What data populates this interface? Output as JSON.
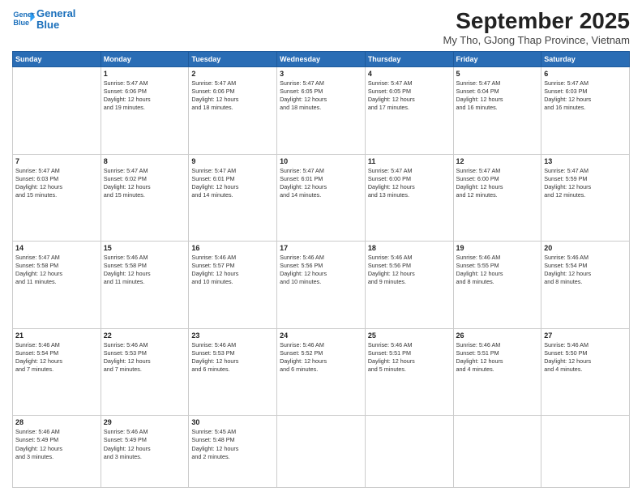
{
  "header": {
    "logo_line1": "General",
    "logo_line2": "Blue",
    "title": "September 2025",
    "subtitle": "My Tho, GJong Thap Province, Vietnam"
  },
  "weekdays": [
    "Sunday",
    "Monday",
    "Tuesday",
    "Wednesday",
    "Thursday",
    "Friday",
    "Saturday"
  ],
  "weeks": [
    [
      {
        "day": "",
        "info": ""
      },
      {
        "day": "1",
        "info": "Sunrise: 5:47 AM\nSunset: 6:06 PM\nDaylight: 12 hours\nand 19 minutes."
      },
      {
        "day": "2",
        "info": "Sunrise: 5:47 AM\nSunset: 6:06 PM\nDaylight: 12 hours\nand 18 minutes."
      },
      {
        "day": "3",
        "info": "Sunrise: 5:47 AM\nSunset: 6:05 PM\nDaylight: 12 hours\nand 18 minutes."
      },
      {
        "day": "4",
        "info": "Sunrise: 5:47 AM\nSunset: 6:05 PM\nDaylight: 12 hours\nand 17 minutes."
      },
      {
        "day": "5",
        "info": "Sunrise: 5:47 AM\nSunset: 6:04 PM\nDaylight: 12 hours\nand 16 minutes."
      },
      {
        "day": "6",
        "info": "Sunrise: 5:47 AM\nSunset: 6:03 PM\nDaylight: 12 hours\nand 16 minutes."
      }
    ],
    [
      {
        "day": "7",
        "info": "Sunrise: 5:47 AM\nSunset: 6:03 PM\nDaylight: 12 hours\nand 15 minutes."
      },
      {
        "day": "8",
        "info": "Sunrise: 5:47 AM\nSunset: 6:02 PM\nDaylight: 12 hours\nand 15 minutes."
      },
      {
        "day": "9",
        "info": "Sunrise: 5:47 AM\nSunset: 6:01 PM\nDaylight: 12 hours\nand 14 minutes."
      },
      {
        "day": "10",
        "info": "Sunrise: 5:47 AM\nSunset: 6:01 PM\nDaylight: 12 hours\nand 14 minutes."
      },
      {
        "day": "11",
        "info": "Sunrise: 5:47 AM\nSunset: 6:00 PM\nDaylight: 12 hours\nand 13 minutes."
      },
      {
        "day": "12",
        "info": "Sunrise: 5:47 AM\nSunset: 6:00 PM\nDaylight: 12 hours\nand 12 minutes."
      },
      {
        "day": "13",
        "info": "Sunrise: 5:47 AM\nSunset: 5:59 PM\nDaylight: 12 hours\nand 12 minutes."
      }
    ],
    [
      {
        "day": "14",
        "info": "Sunrise: 5:47 AM\nSunset: 5:58 PM\nDaylight: 12 hours\nand 11 minutes."
      },
      {
        "day": "15",
        "info": "Sunrise: 5:46 AM\nSunset: 5:58 PM\nDaylight: 12 hours\nand 11 minutes."
      },
      {
        "day": "16",
        "info": "Sunrise: 5:46 AM\nSunset: 5:57 PM\nDaylight: 12 hours\nand 10 minutes."
      },
      {
        "day": "17",
        "info": "Sunrise: 5:46 AM\nSunset: 5:56 PM\nDaylight: 12 hours\nand 10 minutes."
      },
      {
        "day": "18",
        "info": "Sunrise: 5:46 AM\nSunset: 5:56 PM\nDaylight: 12 hours\nand 9 minutes."
      },
      {
        "day": "19",
        "info": "Sunrise: 5:46 AM\nSunset: 5:55 PM\nDaylight: 12 hours\nand 8 minutes."
      },
      {
        "day": "20",
        "info": "Sunrise: 5:46 AM\nSunset: 5:54 PM\nDaylight: 12 hours\nand 8 minutes."
      }
    ],
    [
      {
        "day": "21",
        "info": "Sunrise: 5:46 AM\nSunset: 5:54 PM\nDaylight: 12 hours\nand 7 minutes."
      },
      {
        "day": "22",
        "info": "Sunrise: 5:46 AM\nSunset: 5:53 PM\nDaylight: 12 hours\nand 7 minutes."
      },
      {
        "day": "23",
        "info": "Sunrise: 5:46 AM\nSunset: 5:53 PM\nDaylight: 12 hours\nand 6 minutes."
      },
      {
        "day": "24",
        "info": "Sunrise: 5:46 AM\nSunset: 5:52 PM\nDaylight: 12 hours\nand 6 minutes."
      },
      {
        "day": "25",
        "info": "Sunrise: 5:46 AM\nSunset: 5:51 PM\nDaylight: 12 hours\nand 5 minutes."
      },
      {
        "day": "26",
        "info": "Sunrise: 5:46 AM\nSunset: 5:51 PM\nDaylight: 12 hours\nand 4 minutes."
      },
      {
        "day": "27",
        "info": "Sunrise: 5:46 AM\nSunset: 5:50 PM\nDaylight: 12 hours\nand 4 minutes."
      }
    ],
    [
      {
        "day": "28",
        "info": "Sunrise: 5:46 AM\nSunset: 5:49 PM\nDaylight: 12 hours\nand 3 minutes."
      },
      {
        "day": "29",
        "info": "Sunrise: 5:46 AM\nSunset: 5:49 PM\nDaylight: 12 hours\nand 3 minutes."
      },
      {
        "day": "30",
        "info": "Sunrise: 5:45 AM\nSunset: 5:48 PM\nDaylight: 12 hours\nand 2 minutes."
      },
      {
        "day": "",
        "info": ""
      },
      {
        "day": "",
        "info": ""
      },
      {
        "day": "",
        "info": ""
      },
      {
        "day": "",
        "info": ""
      }
    ]
  ]
}
